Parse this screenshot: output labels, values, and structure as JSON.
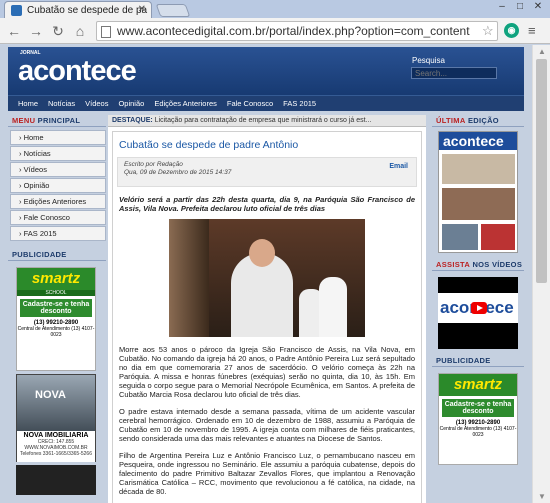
{
  "browser": {
    "tab_title": "Cubatão se despede de pa",
    "url": "www.acontecedigital.com.br/portal/index.php?option=com_content"
  },
  "site": {
    "logo_small": "JORNAL",
    "logo": "acontece",
    "search_label": "Pesquisa",
    "search_placeholder": "Search..."
  },
  "mainnav": [
    "Home",
    "Notícias",
    "Vídeos",
    "Opinião",
    "Edições Anteriores",
    "Fale Conosco",
    "FAS 2015"
  ],
  "left_sidebar": {
    "menu_heading_a": "MENU",
    "menu_heading_b": " PRINCIPAL",
    "menu_items": [
      "Home",
      "Notícias",
      "Vídeos",
      "Opinião",
      "Edições Anteriores",
      "Fale Conosco",
      "FAS 2015"
    ],
    "ads_heading": "PUBLICIDADE",
    "ad_smartz": {
      "brand": "smartz",
      "sub": "SCHOOL",
      "cta": "Cadastre-se e tenha desconto",
      "phone": "(13) 99210-2890",
      "central": "Central de Atendimento (13) 4107-0023"
    },
    "ad_nova": {
      "brand": "NOVA",
      "title": "NOVA IMOBILIARIA",
      "creci": "CRECI: 147.855",
      "site": "WWW.NOVAIMOB.COM.BR",
      "phones": "Telefones 3361-1665/3365-5266"
    }
  },
  "content": {
    "destaque_label": "DESTAQUE:",
    "destaque_text": "Licitação para contratação de empresa que ministrará o curso já est...",
    "title": "Cubatão se despede de padre Antônio",
    "author": "Escrito por Redação",
    "date": "Qua, 09 de Dezembro de 2015 14:37",
    "email": "Email",
    "lead": "Velório será a partir das 22h desta quarta, dia 9, na Paróquia São Francisco de Assis, Vila Nova. Prefeita declarou luto oficial de três dias",
    "p1": "Morre aos 53 anos o pároco da Igreja São Francisco de Assis, na Vila Nova, em Cubatão. No comando da igreja há 20 anos, o Padre Antônio Pereira Luz será sepultado no dia em que comemoraria 27 anos de sacerdócio. O velório começa às 22h na Paróquia. A missa e honras fúnebres (exéquias) serão no quinta, dia 10, às 15h. Em seguida o corpo segue para o Memorial Necrópole Ecumênica, em Santos. A prefeita de Cubatão Marcia Rosa declarou luto oficial de três dias.",
    "p2": "O padre estava internado desde a semana passada, vítima de um acidente vascular cerebral hemorrágico. Ordenado em 10 de dezembro de 1988, assumiu a Paróquia de Cubatão em 10 de novembro de 1995. A igreja conta com milhares de fiéis praticantes, sendo considerada uma das mais relevantes e atuantes na Diocese de Santos.",
    "p3": "Filho de Argentina Pereira Luz e Antônio Francisco Luz, o pernambucano nasceu em Pesqueira, onde ingressou no Seminário. Ele assumiu a paróquia cubatense, depois do falecimento do padre Primitivo Baltazar Zevallos Flores, que implantou a Renovação Carismática Católica – RCC, movimento que revolucionou a fé católica, na cidade, na década de 80."
  },
  "right_sidebar": {
    "ultima_a": "ÚLTIMA",
    "ultima_b": " EDIÇÃO",
    "cover_logo": "acontece",
    "videos_a": "ASSISTA",
    "videos_b": " NOS VÍDEOS",
    "video_logo": "acontece",
    "ads_heading": "PUBLICIDADE",
    "ad_smartz": {
      "brand": "smartz",
      "cta": "Cadastre-se e tenha desconto",
      "phone": "(13) 99210-2890",
      "central": "Central de Atendimento (13) 4107-0023"
    }
  }
}
